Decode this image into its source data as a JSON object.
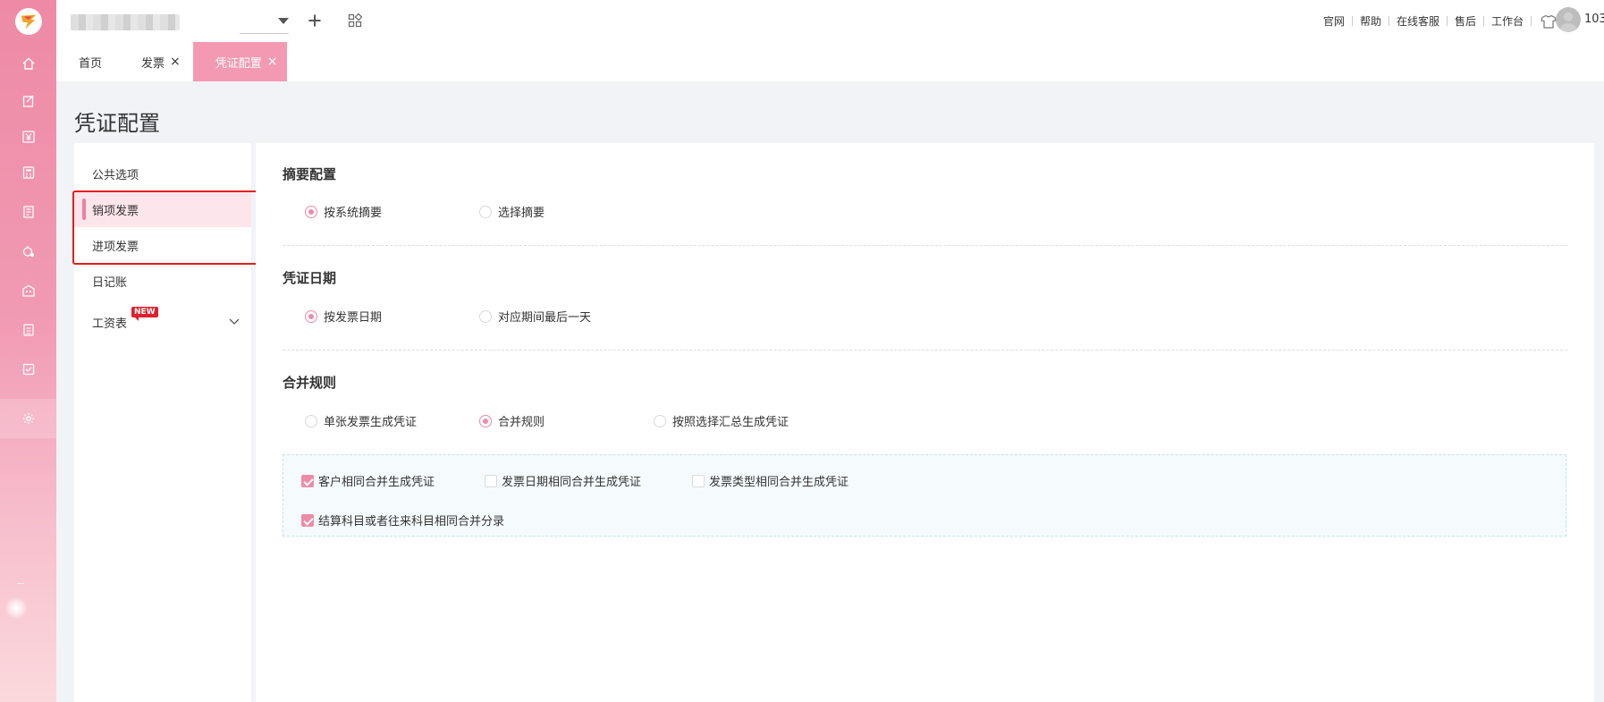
{
  "topbar": {
    "links": [
      "官网",
      "帮助",
      "在线客服",
      "售后",
      "工作台"
    ],
    "user_id": "103"
  },
  "tabs": [
    {
      "label": "首页",
      "closable": false
    },
    {
      "label": "发票",
      "closable": true
    },
    {
      "label": "凭证配置",
      "closable": true,
      "active": true
    }
  ],
  "page_title": "凭证配置",
  "sidemenu": {
    "items": [
      {
        "label": "公共选项"
      },
      {
        "label": "销项发票",
        "active": true
      },
      {
        "label": "进项发票"
      },
      {
        "label": "日记账"
      },
      {
        "label": "工资表",
        "badge": "NEW",
        "expandable": true
      }
    ]
  },
  "summary_config": {
    "title": "摘要配置",
    "options": [
      {
        "label": "按系统摘要",
        "selected": true
      },
      {
        "label": "选择摘要",
        "selected": false
      }
    ]
  },
  "voucher_date": {
    "title": "凭证日期",
    "options": [
      {
        "label": "按发票日期",
        "selected": true
      },
      {
        "label": "对应期间最后一天",
        "selected": false
      }
    ]
  },
  "merge_rules": {
    "title": "合并规则",
    "options": [
      {
        "label": "单张发票生成凭证",
        "selected": false
      },
      {
        "label": "合并规则",
        "selected": true
      },
      {
        "label": "按照选择汇总生成凭证",
        "selected": false
      }
    ],
    "checkboxes": [
      {
        "label": "客户相同合并生成凭证",
        "checked": true
      },
      {
        "label": "发票日期相同合并生成凭证",
        "checked": false
      },
      {
        "label": "发票类型相同合并生成凭证",
        "checked": false
      },
      {
        "label": "结算科目或者往来科目相同合并分录",
        "checked": true
      }
    ]
  },
  "colors": {
    "accent": "#f08aa6",
    "rail": "#ee8aa6",
    "active_tab": "#f39ab2",
    "highlight_border": "#e41e1e"
  },
  "icons": {
    "rail": [
      "home-icon",
      "edit-icon",
      "yuan-icon",
      "calculator-icon",
      "ledger-icon",
      "asset-icon",
      "building-icon",
      "report-icon",
      "tag-icon",
      "settings-icon"
    ]
  }
}
